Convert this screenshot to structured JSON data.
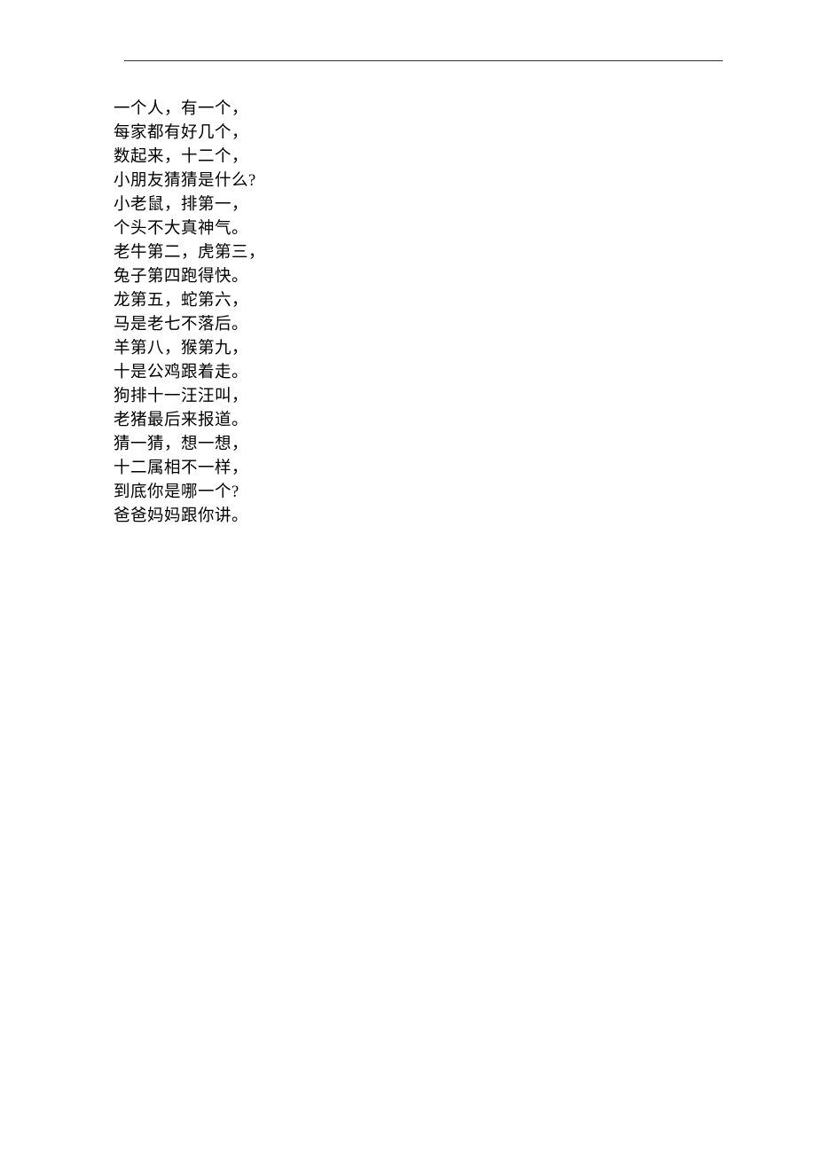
{
  "poem": {
    "lines": [
      "一个人，有一个，",
      "每家都有好几个，",
      "数起来，十二个，",
      "小朋友猜猜是什么?",
      "小老鼠，排第一，",
      "个头不大真神气。",
      "老牛第二，虎第三，",
      "兔子第四跑得快。",
      "龙第五，蛇第六，",
      "马是老七不落后。",
      "羊第八，猴第九，",
      "十是公鸡跟着走。",
      "狗排十一汪汪叫，",
      "老猪最后来报道。",
      "猜一猜，想一想，",
      "十二属相不一样，",
      "到底你是哪一个?",
      "爸爸妈妈跟你讲。"
    ]
  }
}
